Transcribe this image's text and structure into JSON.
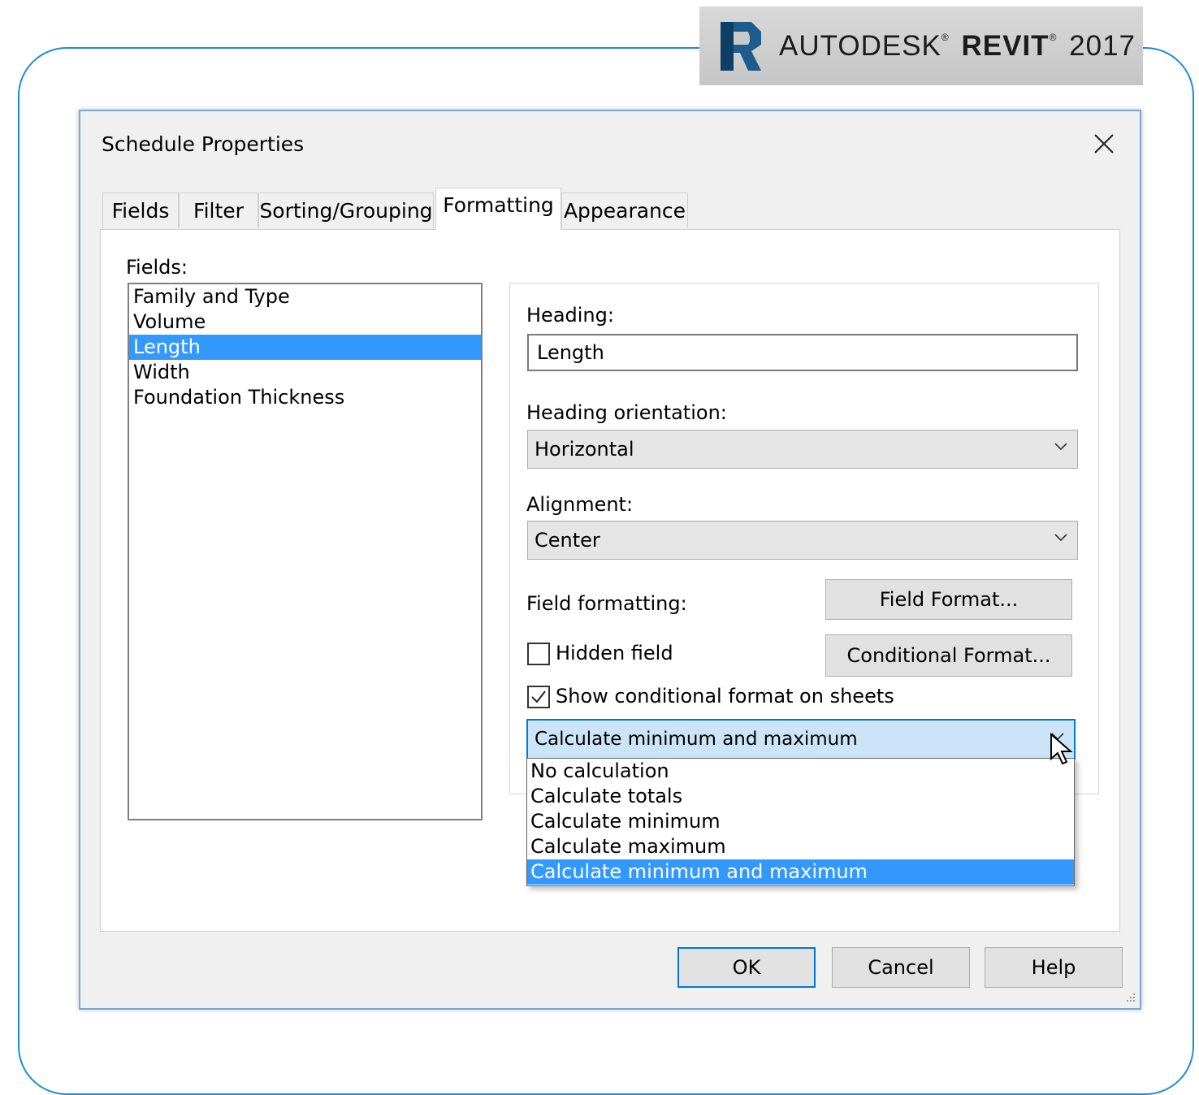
{
  "brand": {
    "name": "AUTODESK",
    "product": "REVIT",
    "version": "2017",
    "reg_mark": "®",
    "logo_letter": "R",
    "accent_color": "#1a8fd1"
  },
  "dialog": {
    "title": "Schedule Properties",
    "close_icon": "close-icon"
  },
  "tabs": [
    {
      "label": "Fields"
    },
    {
      "label": "Filter"
    },
    {
      "label": "Sorting/Grouping"
    },
    {
      "label": "Formatting",
      "active": true
    },
    {
      "label": "Appearance"
    }
  ],
  "fields": {
    "label": "Fields:",
    "items": [
      "Family and Type",
      "Volume",
      "Length",
      "Width",
      "Foundation Thickness"
    ],
    "selected": "Length"
  },
  "formatting": {
    "heading_label": "Heading:",
    "heading_value": "Length",
    "orientation_label": "Heading orientation:",
    "orientation_value": "Horizontal",
    "alignment_label": "Alignment:",
    "alignment_value": "Center",
    "field_formatting_label": "Field formatting:",
    "field_format_button": "Field Format...",
    "hidden_field_label": "Hidden field",
    "hidden_field_checked": false,
    "conditional_format_button": "Conditional  Format...",
    "show_conditional_label": "Show conditional format on sheets",
    "show_conditional_checked": true,
    "calculation_value": "Calculate minimum and maximum",
    "calculation_options": [
      "No calculation",
      "Calculate totals",
      "Calculate minimum",
      "Calculate maximum",
      "Calculate minimum and maximum"
    ],
    "calculation_selected_index": 4
  },
  "footer": {
    "ok": "OK",
    "cancel": "Cancel",
    "help": "Help"
  },
  "colors": {
    "selection": "#3399ff",
    "focus_border": "#0078d7",
    "dialog_bg": "#f0f0f0"
  }
}
